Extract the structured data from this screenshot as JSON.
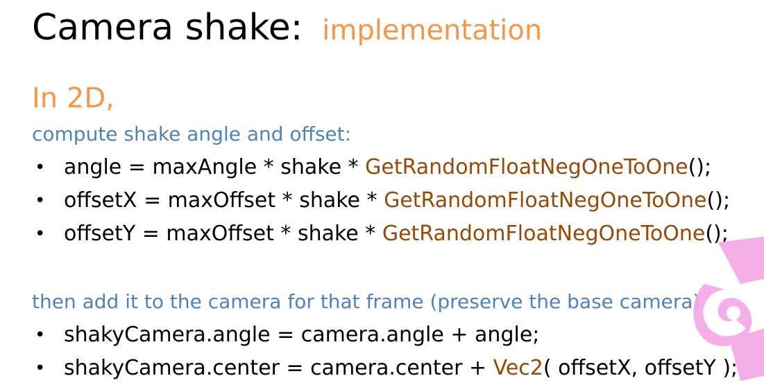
{
  "title": {
    "main": "Camera shake:",
    "sub": "implementation"
  },
  "subheading": "In 2D,",
  "section1": {
    "caption": "compute shake angle and offset:",
    "items": [
      {
        "code": "angle = maxAngle * shake * ",
        "fn": "GetRandomFloatNegOneToOne",
        "tail": "();"
      },
      {
        "code": "offsetX = maxOffset * shake * ",
        "fn": "GetRandomFloatNegOneToOne",
        "tail": "();"
      },
      {
        "code": "offsetY = maxOffset * shake * ",
        "fn": "GetRandomFloatNegOneToOne",
        "tail": "();"
      }
    ]
  },
  "section2": {
    "caption": "then add it to the camera for that frame (preserve the base camera)",
    "items": [
      {
        "code": "shakyCamera.angle = camera.angle + angle;"
      },
      {
        "code": "shakyCamera.center = camera.center + ",
        "fn": "Vec2",
        "tail": "( offsetX, offsetY );"
      }
    ]
  },
  "colors": {
    "accent_orange": "#f79646",
    "caption_blue": "#4f81bd",
    "function_brown": "#984806",
    "watermark_pink": "#f4a6e6"
  },
  "icons": {
    "bullet": "•",
    "watermark": "pink-logo-watermark"
  }
}
